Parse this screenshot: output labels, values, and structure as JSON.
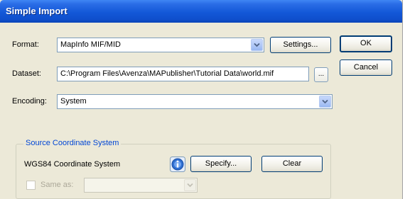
{
  "window": {
    "title": "Simple Import"
  },
  "format": {
    "label": "Format:",
    "value": "MapInfo MIF/MID",
    "settings_button": "Settings..."
  },
  "dataset": {
    "label": "Dataset:",
    "value": "C:\\Program Files\\Avenza\\MAPublisher\\Tutorial Data\\world.mif",
    "browse_button": "..."
  },
  "encoding": {
    "label": "Encoding:",
    "value": "System"
  },
  "buttons": {
    "ok": "OK",
    "cancel": "Cancel"
  },
  "source_coordinate_system": {
    "legend": "Source Coordinate System",
    "current": "WGS84 Coordinate System",
    "specify_button": "Specify...",
    "clear_button": "Clear",
    "same_as_label": "Same as:",
    "same_as_value": ""
  },
  "icons": {
    "combo_arrow": "chevron-down-icon",
    "info": "info-icon"
  },
  "colors": {
    "titlebar": "#1358d8",
    "dialog_bg": "#ece9d8",
    "group_title": "#0046d5",
    "field_border": "#7f9db9"
  }
}
